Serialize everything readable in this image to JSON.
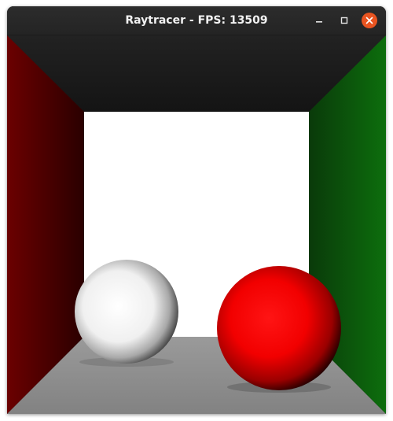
{
  "window": {
    "title": "Raytracer - FPS: 13509",
    "controls": [
      "minimize-icon",
      "maximize-icon",
      "close-icon"
    ]
  },
  "scene": {
    "objects": [
      "ceiling",
      "back-wall",
      "left-wall",
      "right-wall",
      "floor",
      "white-sphere",
      "red-sphere"
    ],
    "colors": {
      "ceiling": "#1b1b1b",
      "back_wall": "#ffffff",
      "left_wall": "#6e0000",
      "right_wall": "#0b6e0b",
      "floor": "#8a8a8a",
      "white_sphere": "#ffffff",
      "red_sphere": "#ff0000",
      "close_button": "#e95420"
    }
  }
}
